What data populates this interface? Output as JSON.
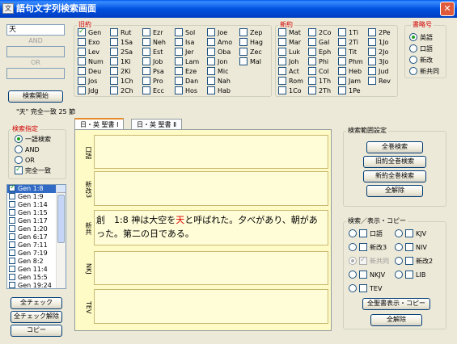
{
  "window": {
    "title": "語句文字列検索画面",
    "close": "✕",
    "icon": "文"
  },
  "search": {
    "query": "天",
    "and_label": "AND",
    "or_label": "OR",
    "start_button": "検索開始",
    "result_summary": "\"天\" 完全一致 25 節"
  },
  "old_testament": {
    "title": "旧約",
    "books": [
      [
        "Gen",
        "Exo",
        "Lev",
        "Num",
        "Deu",
        "Jos",
        "Jdg"
      ],
      [
        "Rut",
        "1Sa",
        "2Sa",
        "1Ki",
        "2Ki",
        "1Ch",
        "2Ch"
      ],
      [
        "Ezr",
        "Neh",
        "Est",
        "Job",
        "Psa",
        "Pro",
        "Ecc"
      ],
      [
        "Sol",
        "Isa",
        "Jer",
        "Lam",
        "Eze",
        "Dan",
        "Hos"
      ],
      [
        "Joe",
        "Amo",
        "Oba",
        "Jon",
        "Mic",
        "Nah",
        "Hab"
      ],
      [
        "Zep",
        "Hag",
        "Zec",
        "Mal"
      ]
    ],
    "checked": [
      "Gen"
    ]
  },
  "new_testament": {
    "title": "新約",
    "books": [
      [
        "Mat",
        "Mar",
        "Luk",
        "Joh",
        "Act",
        "Rom",
        "1Co"
      ],
      [
        "2Co",
        "Gal",
        "Eph",
        "Phi",
        "Col",
        "1Th",
        "2Th"
      ],
      [
        "1Ti",
        "2Ti",
        "Tit",
        "Phm",
        "Heb",
        "Jam",
        "1Pe"
      ],
      [
        "2Pe",
        "1Jo",
        "2Jo",
        "3Jo",
        "Jud",
        "Rev"
      ]
    ]
  },
  "abbrev": {
    "title": "書略号",
    "options": [
      "英語",
      "口語",
      "新改",
      "新共同"
    ],
    "selected": "英語"
  },
  "search_spec": {
    "title": "検索指定",
    "options": [
      "一語検索",
      "AND",
      "OR"
    ],
    "selected": "一語検索",
    "exact_label": "完全一致",
    "exact_checked": true
  },
  "results": [
    {
      "ref": "Gen  1:8",
      "checked": true,
      "selected": true
    },
    {
      "ref": "Gen  1:9"
    },
    {
      "ref": "Gen  1:14"
    },
    {
      "ref": "Gen  1:15"
    },
    {
      "ref": "Gen  1:17"
    },
    {
      "ref": "Gen  1:20"
    },
    {
      "ref": "Gen  6:17"
    },
    {
      "ref": "Gen  7:11"
    },
    {
      "ref": "Gen  7:19"
    },
    {
      "ref": "Gen  8:2"
    },
    {
      "ref": "Gen  11:4"
    },
    {
      "ref": "Gen  15:5"
    },
    {
      "ref": "Gen  19:24"
    }
  ],
  "list_buttons": {
    "check_all": "全チェック",
    "uncheck_all": "全チェック解除",
    "copy": "コピー"
  },
  "tabs": [
    "日・英 聖書 Ⅰ",
    "日・英 聖書 Ⅱ"
  ],
  "version_rows": [
    {
      "label": "口語",
      "text": ""
    },
    {
      "label": "新改3",
      "text": ""
    },
    {
      "label": "新共",
      "pre": "創　1:8 神は大空を",
      "hl": "天",
      "post": "と呼ばれた。夕べがあり、朝があった。第二の日である。"
    },
    {
      "label": "NKJ",
      "text": ""
    },
    {
      "label": "TEV",
      "text": ""
    }
  ],
  "range": {
    "title": "検索範囲設定",
    "buttons": [
      "全巻検索",
      "旧約全巻検索",
      "新約全巻検索",
      "全解除"
    ]
  },
  "display": {
    "title": "検索／表示・コピー",
    "left": [
      {
        "label": "口語",
        "radio": false,
        "check": false
      },
      {
        "label": "新改3",
        "radio": false,
        "check": false
      },
      {
        "label": "新共同",
        "radio": true,
        "check": true,
        "dim": true
      },
      {
        "label": "NKJV",
        "radio": false,
        "check": false
      },
      {
        "label": "TEV",
        "radio": false,
        "check": false
      }
    ],
    "right": [
      {
        "label": "KJV"
      },
      {
        "label": "NIV"
      },
      {
        "label": "新改2"
      },
      {
        "label": "LIB"
      }
    ],
    "show_copy_button": "全聖書表示・コピー",
    "clear_button": "全解除"
  }
}
